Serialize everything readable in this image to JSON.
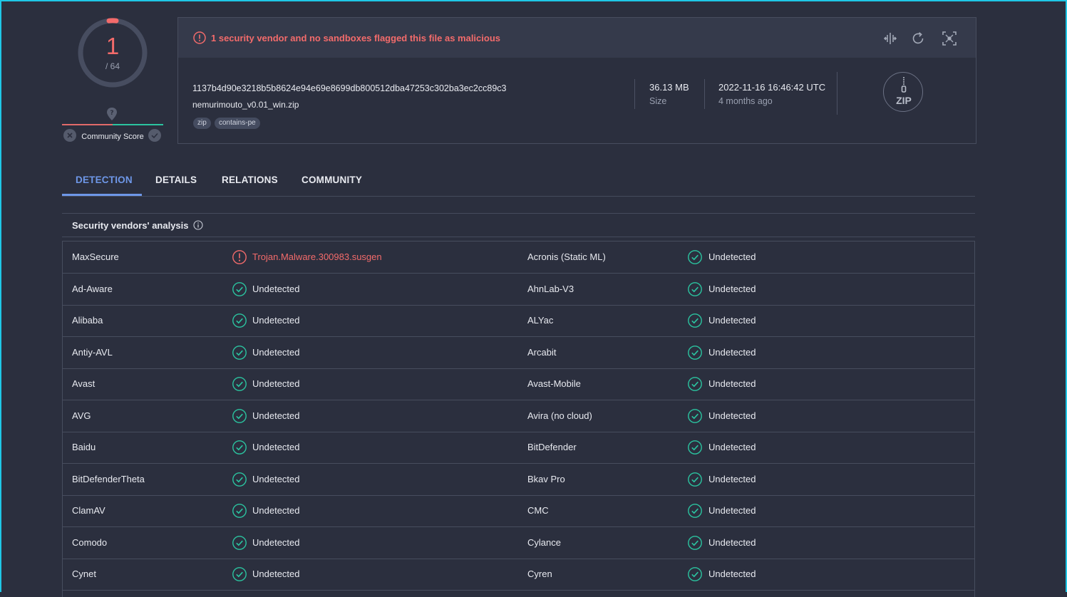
{
  "score": {
    "detections": "1",
    "total": "/ 64"
  },
  "community": {
    "label": "Community Score"
  },
  "banner": {
    "text": "1 security vendor and no sandboxes flagged this file as malicious"
  },
  "file": {
    "hash": "1137b4d90e3218b5b8624e94e69e8699db800512dba47253c302ba3ec2cc89c3",
    "name": "nemurimouto_v0.01_win.zip",
    "tags": [
      "zip",
      "contains-pe"
    ],
    "size_value": "36.13 MB",
    "size_label": "Size",
    "date_value": "2022-11-16 16:46:42 UTC",
    "date_ago": "4 months ago",
    "type_badge": "ZIP"
  },
  "tabs": [
    "DETECTION",
    "DETAILS",
    "RELATIONS",
    "COMMUNITY"
  ],
  "section_title": "Security vendors' analysis",
  "colors": {
    "malicious": "#f36b6b",
    "clean": "#2bc4a0",
    "accent": "#6e97e8"
  },
  "rows": [
    {
      "left": {
        "vendor": "MaxSecure",
        "result": "Trojan.Malware.300983.susgen",
        "status": "malicious"
      },
      "right": {
        "vendor": "Acronis (Static ML)",
        "result": "Undetected",
        "status": "clean"
      }
    },
    {
      "left": {
        "vendor": "Ad-Aware",
        "result": "Undetected",
        "status": "clean"
      },
      "right": {
        "vendor": "AhnLab-V3",
        "result": "Undetected",
        "status": "clean"
      }
    },
    {
      "left": {
        "vendor": "Alibaba",
        "result": "Undetected",
        "status": "clean"
      },
      "right": {
        "vendor": "ALYac",
        "result": "Undetected",
        "status": "clean"
      }
    },
    {
      "left": {
        "vendor": "Antiy-AVL",
        "result": "Undetected",
        "status": "clean"
      },
      "right": {
        "vendor": "Arcabit",
        "result": "Undetected",
        "status": "clean"
      }
    },
    {
      "left": {
        "vendor": "Avast",
        "result": "Undetected",
        "status": "clean"
      },
      "right": {
        "vendor": "Avast-Mobile",
        "result": "Undetected",
        "status": "clean"
      }
    },
    {
      "left": {
        "vendor": "AVG",
        "result": "Undetected",
        "status": "clean"
      },
      "right": {
        "vendor": "Avira (no cloud)",
        "result": "Undetected",
        "status": "clean"
      }
    },
    {
      "left": {
        "vendor": "Baidu",
        "result": "Undetected",
        "status": "clean"
      },
      "right": {
        "vendor": "BitDefender",
        "result": "Undetected",
        "status": "clean"
      }
    },
    {
      "left": {
        "vendor": "BitDefenderTheta",
        "result": "Undetected",
        "status": "clean"
      },
      "right": {
        "vendor": "Bkav Pro",
        "result": "Undetected",
        "status": "clean"
      }
    },
    {
      "left": {
        "vendor": "ClamAV",
        "result": "Undetected",
        "status": "clean"
      },
      "right": {
        "vendor": "CMC",
        "result": "Undetected",
        "status": "clean"
      }
    },
    {
      "left": {
        "vendor": "Comodo",
        "result": "Undetected",
        "status": "clean"
      },
      "right": {
        "vendor": "Cylance",
        "result": "Undetected",
        "status": "clean"
      }
    },
    {
      "left": {
        "vendor": "Cynet",
        "result": "Undetected",
        "status": "clean"
      },
      "right": {
        "vendor": "Cyren",
        "result": "Undetected",
        "status": "clean"
      }
    }
  ]
}
